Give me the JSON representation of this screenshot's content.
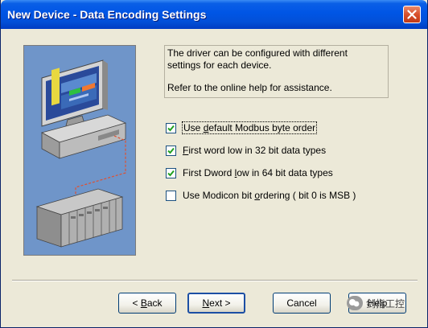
{
  "window": {
    "title": "New Device - Data Encoding Settings"
  },
  "info": {
    "line1": "The driver can be configured with different",
    "line2": "settings for each device.",
    "line3": "Refer to the online help for assistance."
  },
  "options": [
    {
      "pre": "Use ",
      "key": "d",
      "post": "efault Modbus byte order",
      "checked": true
    },
    {
      "pre": "",
      "key": "F",
      "post": "irst word low in 32 bit data types",
      "checked": true
    },
    {
      "pre": "First Dword ",
      "key": "l",
      "post": "ow in 64 bit data types",
      "checked": true
    },
    {
      "pre": "Use Modicon bit ",
      "key": "o",
      "post": "rdering ( bit 0 is MSB )",
      "checked": false
    }
  ],
  "buttons": {
    "back": {
      "pre": "< ",
      "key": "B",
      "post": "ack"
    },
    "next": {
      "pre": "",
      "key": "N",
      "post": "ext >"
    },
    "cancel": "Cancel",
    "help": "Help"
  },
  "watermark": "剑指工控"
}
